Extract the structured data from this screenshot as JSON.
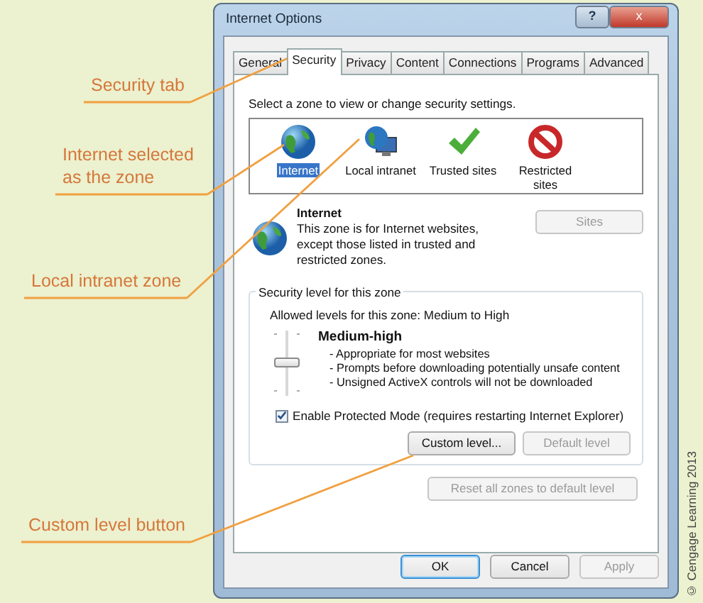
{
  "callouts": [
    {
      "text": "Security tab"
    },
    {
      "text": "Internet selected as the zone"
    },
    {
      "text": "Local intranet zone"
    },
    {
      "text": "Custom level button"
    }
  ],
  "window": {
    "title": "Internet Options",
    "title_buttons": [
      "?",
      "x"
    ]
  },
  "tabs": [
    {
      "label": "General",
      "selected": false
    },
    {
      "label": "Security",
      "selected": true
    },
    {
      "label": "Privacy",
      "selected": false
    },
    {
      "label": "Content",
      "selected": false
    },
    {
      "label": "Connections",
      "selected": false
    },
    {
      "label": "Programs",
      "selected": false
    },
    {
      "label": "Advanced",
      "selected": false
    }
  ],
  "zone_prompt": "Select a zone to view or change security settings.",
  "zones": [
    {
      "label": "Internet",
      "kind": "globe",
      "selected": true
    },
    {
      "label": "Local intranet",
      "kind": "intranet",
      "selected": false
    },
    {
      "label": "Trusted sites",
      "kind": "check",
      "selected": false
    },
    {
      "label": "Restricted sites",
      "kind": "block",
      "selected": false
    }
  ],
  "zone_info": {
    "name": "Internet",
    "description": "This zone is for Internet websites, except those listed in trusted and restricted zones.",
    "sites_button": {
      "label": "Sites",
      "disabled": true
    }
  },
  "security_level": {
    "group_title": "Security level for this zone",
    "allowed": "Allowed levels for this zone: Medium to High",
    "level": 0.5,
    "level_name": "Medium-high",
    "bullets": [
      "- Appropriate for most websites",
      "- Prompts before downloading potentially unsafe content",
      "- Unsigned ActiveX controls will not be downloaded"
    ],
    "protected_mode": {
      "label": "Enable Protected Mode (requires restarting Internet Explorer)",
      "checked": true
    },
    "buttons": [
      {
        "label": "Custom level...",
        "disabled": false
      },
      {
        "label": "Default level",
        "disabled": true
      }
    ]
  },
  "reset_button": {
    "label": "Reset all zones to default level",
    "disabled": true
  },
  "dialog_buttons": [
    {
      "label": "OK",
      "default": true,
      "disabled": false
    },
    {
      "label": "Cancel",
      "default": false,
      "disabled": false
    },
    {
      "label": "Apply",
      "default": false,
      "disabled": true
    }
  ],
  "copyright": "© Cengage Learning 2013"
}
